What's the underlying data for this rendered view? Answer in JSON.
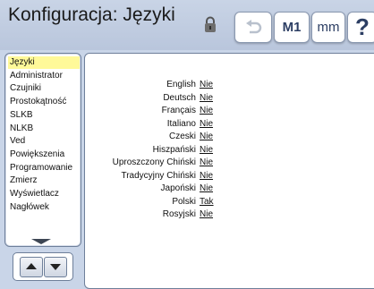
{
  "header": {
    "title": "Konfiguracja: Języki",
    "lock_icon": "lock-icon",
    "undo_icon": "undo-arrow-icon",
    "unit_m1": "M1",
    "unit_mm": "mm",
    "help": "?"
  },
  "menu": {
    "items": [
      {
        "label": "Języki",
        "active": true
      },
      {
        "label": "Administrator"
      },
      {
        "label": "Czujniki"
      },
      {
        "label": "Prostokątność"
      },
      {
        "label": "SLKB"
      },
      {
        "label": "NLKB"
      },
      {
        "label": "Ved"
      },
      {
        "label": "Powiększenia"
      },
      {
        "label": "Programowanie"
      },
      {
        "label": "Zmierz"
      },
      {
        "label": "Wyświetlacz"
      },
      {
        "label": "Nagłówek"
      }
    ],
    "more_icon": "triangle-down-icon",
    "scroll_up_icon": "arrow-up-icon",
    "scroll_down_icon": "arrow-down-icon"
  },
  "languages": [
    {
      "name": "English",
      "value": "Nie"
    },
    {
      "name": "Deutsch",
      "value": "Nie"
    },
    {
      "name": "Français",
      "value": "Nie"
    },
    {
      "name": "Italiano",
      "value": "Nie"
    },
    {
      "name": "Czeski",
      "value": "Nie"
    },
    {
      "name": "Hiszpański",
      "value": "Nie"
    },
    {
      "name": "Uproszczony Chiński",
      "value": "Nie"
    },
    {
      "name": "Tradycyjny Chiński",
      "value": "Nie"
    },
    {
      "name": "Japoński",
      "value": "Nie"
    },
    {
      "name": "Polski",
      "value": "Tak"
    },
    {
      "name": "Rosyjski",
      "value": "Nie"
    }
  ],
  "colors": {
    "background": "#c9d5e8",
    "active_menu_highlight": "#fff999",
    "button_text": "#2c3e63"
  }
}
